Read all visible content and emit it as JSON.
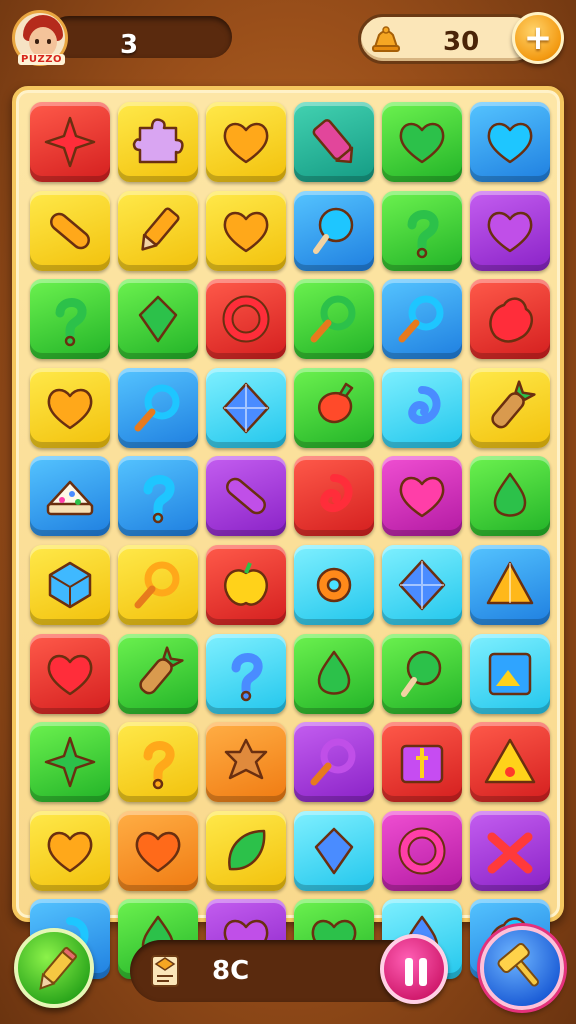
{
  "header": {
    "brand_label": "PUZZO",
    "lives_count": "3",
    "coins_count": "30",
    "add_label": "+"
  },
  "footer": {
    "moves_count": "8C"
  },
  "colors": {
    "red": "#e0322a",
    "yellow": "#f5cf1c",
    "teal": "#22b399",
    "green": "#38c833",
    "blue": "#2b95ee",
    "cyan": "#3ed8f5",
    "purple": "#9b34d6",
    "magenta": "#cc2ab8",
    "orange": "#f48a1e"
  },
  "board": {
    "rows": [
      [
        {
          "color": "red",
          "icon": "star-icon"
        },
        {
          "color": "yellow",
          "icon": "puzzle-piece-icon"
        },
        {
          "color": "yellow",
          "icon": "heart-icon"
        },
        {
          "color": "teal",
          "icon": "crystal-icon"
        },
        {
          "color": "green",
          "icon": "heart-icon"
        },
        {
          "color": "blue",
          "icon": "heart-icon"
        }
      ],
      [
        {
          "color": "yellow",
          "icon": "capsule-icon"
        },
        {
          "color": "yellow",
          "icon": "pencil-icon"
        },
        {
          "color": "yellow",
          "icon": "heart-icon"
        },
        {
          "color": "blue",
          "icon": "lollipop-icon"
        },
        {
          "color": "green",
          "icon": "hook-icon"
        },
        {
          "color": "purple",
          "icon": "heart-icon"
        }
      ],
      [
        {
          "color": "green",
          "icon": "hook-icon"
        },
        {
          "color": "green",
          "icon": "gem-icon"
        },
        {
          "color": "red",
          "icon": "ring-icon"
        },
        {
          "color": "green",
          "icon": "magnifier-icon"
        },
        {
          "color": "blue",
          "icon": "magnifier-icon"
        },
        {
          "color": "red",
          "icon": "blob-icon"
        }
      ],
      [
        {
          "color": "yellow",
          "icon": "heart-icon"
        },
        {
          "color": "blue",
          "icon": "magnifier-icon"
        },
        {
          "color": "cyan",
          "icon": "diamond-icon"
        },
        {
          "color": "green",
          "icon": "pepper-icon"
        },
        {
          "color": "cyan",
          "icon": "swirl-icon"
        },
        {
          "color": "yellow",
          "icon": "carrot-icon"
        }
      ],
      [
        {
          "color": "blue",
          "icon": "cake-icon"
        },
        {
          "color": "blue",
          "icon": "hook-icon"
        },
        {
          "color": "purple",
          "icon": "capsule-icon"
        },
        {
          "color": "red",
          "icon": "swirl-icon"
        },
        {
          "color": "magenta",
          "icon": "heart-icon"
        },
        {
          "color": "green",
          "icon": "drop-icon"
        }
      ],
      [
        {
          "color": "yellow",
          "icon": "cube-icon"
        },
        {
          "color": "yellow",
          "icon": "magnifier-icon"
        },
        {
          "color": "red",
          "icon": "apple-icon"
        },
        {
          "color": "cyan",
          "icon": "gear-icon"
        },
        {
          "color": "cyan",
          "icon": "diamond-icon"
        },
        {
          "color": "blue",
          "icon": "pyramid-icon"
        }
      ],
      [
        {
          "color": "red",
          "icon": "heart-icon"
        },
        {
          "color": "green",
          "icon": "carrot-icon"
        },
        {
          "color": "cyan",
          "icon": "hook-icon"
        },
        {
          "color": "green",
          "icon": "drop-icon"
        },
        {
          "color": "green",
          "icon": "lollipop-icon"
        },
        {
          "color": "cyan",
          "icon": "picture-icon"
        }
      ],
      [
        {
          "color": "green",
          "icon": "star-icon"
        },
        {
          "color": "yellow",
          "icon": "hook-icon"
        },
        {
          "color": "orange",
          "icon": "cookie-icon"
        },
        {
          "color": "purple",
          "icon": "magnifier-icon"
        },
        {
          "color": "red",
          "icon": "gift-icon"
        },
        {
          "color": "red",
          "icon": "warning-icon"
        }
      ],
      [
        {
          "color": "yellow",
          "icon": "heart-icon"
        },
        {
          "color": "orange",
          "icon": "heart-icon"
        },
        {
          "color": "yellow",
          "icon": "leaf-icon"
        },
        {
          "color": "cyan",
          "icon": "gem-icon"
        },
        {
          "color": "magenta",
          "icon": "ring-icon"
        },
        {
          "color": "purple",
          "icon": "bow-icon"
        }
      ],
      [
        {
          "color": "blue",
          "icon": "swirl-icon"
        },
        {
          "color": "green",
          "icon": "drop-icon"
        },
        {
          "color": "purple",
          "icon": "heart-icon"
        },
        {
          "color": "green",
          "icon": "heart-icon"
        },
        {
          "color": "cyan",
          "icon": "drop-icon"
        },
        {
          "color": "blue",
          "icon": "blob-icon"
        }
      ]
    ]
  }
}
